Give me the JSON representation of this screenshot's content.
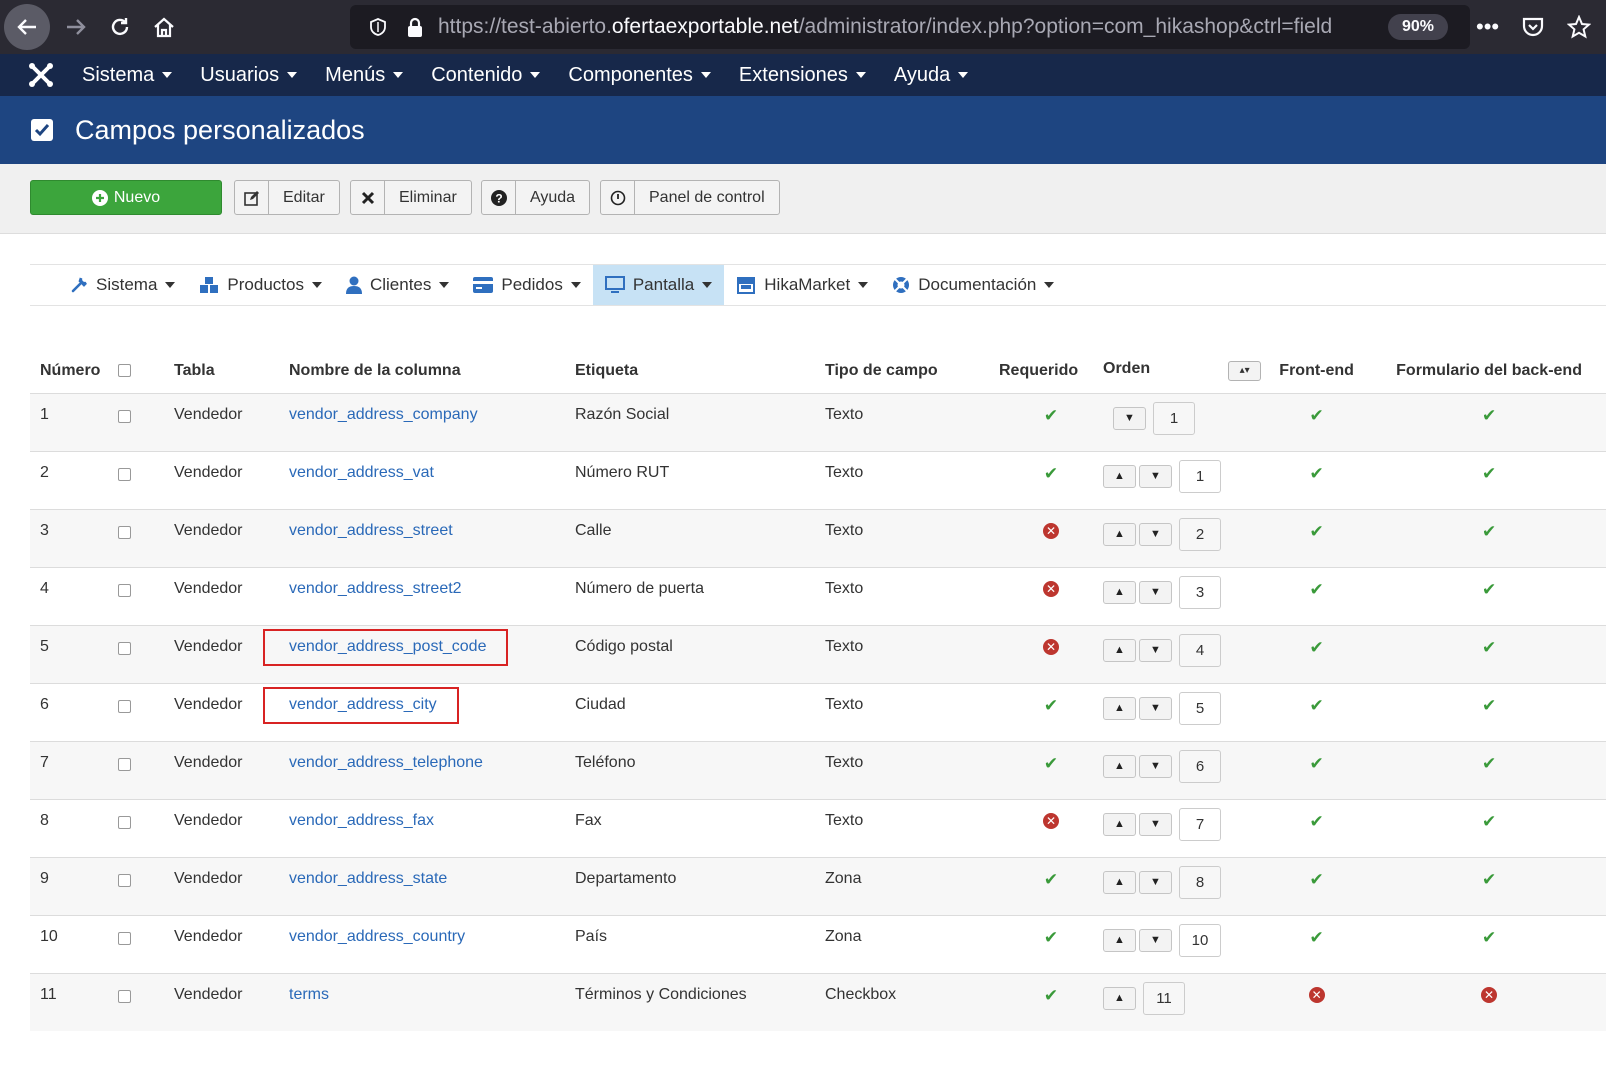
{
  "browser": {
    "url_prefix": "https://test-abierto.",
    "url_host": "ofertaexportable.net",
    "url_path": "/administrator/index.php?option=com_hikashop&ctrl=field",
    "zoom": "90%"
  },
  "topmenu": [
    "Sistema",
    "Usuarios",
    "Menús",
    "Contenido",
    "Componentes",
    "Extensiones",
    "Ayuda"
  ],
  "header": {
    "title": "Campos personalizados"
  },
  "toolbar": {
    "new": "Nuevo",
    "edit": "Editar",
    "delete": "Eliminar",
    "help": "Ayuda",
    "panel": "Panel de control"
  },
  "hikamenu": [
    "Sistema",
    "Productos",
    "Clientes",
    "Pedidos",
    "Pantalla",
    "HikaMarket",
    "Documentación"
  ],
  "table": {
    "headers": {
      "num": "Número",
      "tabla": "Tabla",
      "columna": "Nombre de la columna",
      "etiqueta": "Etiqueta",
      "tipo": "Tipo de campo",
      "requerido": "Requerido",
      "orden": "Orden",
      "front": "Front-end",
      "back": "Formulario del back-end"
    },
    "rows": [
      {
        "num": "1",
        "tabla": "Vendedor",
        "col": "vendor_address_company",
        "label": "Razón Social",
        "tipo": "Texto",
        "req": true,
        "ord": "1",
        "front": true,
        "back": true
      },
      {
        "num": "2",
        "tabla": "Vendedor",
        "col": "vendor_address_vat",
        "label": "Número RUT",
        "tipo": "Texto",
        "req": true,
        "ord": "1",
        "front": true,
        "back": true
      },
      {
        "num": "3",
        "tabla": "Vendedor",
        "col": "vendor_address_street",
        "label": "Calle",
        "tipo": "Texto",
        "req": false,
        "ord": "2",
        "front": true,
        "back": true
      },
      {
        "num": "4",
        "tabla": "Vendedor",
        "col": "vendor_address_street2",
        "label": "Número de puerta",
        "tipo": "Texto",
        "req": false,
        "ord": "3",
        "front": true,
        "back": true
      },
      {
        "num": "5",
        "tabla": "Vendedor",
        "col": "vendor_address_post_code",
        "label": "Código postal",
        "tipo": "Texto",
        "req": false,
        "ord": "4",
        "front": true,
        "back": true
      },
      {
        "num": "6",
        "tabla": "Vendedor",
        "col": "vendor_address_city",
        "label": "Ciudad",
        "tipo": "Texto",
        "req": true,
        "ord": "5",
        "front": true,
        "back": true
      },
      {
        "num": "7",
        "tabla": "Vendedor",
        "col": "vendor_address_telephone",
        "label": "Teléfono",
        "tipo": "Texto",
        "req": true,
        "ord": "6",
        "front": true,
        "back": true
      },
      {
        "num": "8",
        "tabla": "Vendedor",
        "col": "vendor_address_fax",
        "label": "Fax",
        "tipo": "Texto",
        "req": false,
        "ord": "7",
        "front": true,
        "back": true
      },
      {
        "num": "9",
        "tabla": "Vendedor",
        "col": "vendor_address_state",
        "label": "Departamento",
        "tipo": "Zona",
        "req": true,
        "ord": "8",
        "front": true,
        "back": true
      },
      {
        "num": "10",
        "tabla": "Vendedor",
        "col": "vendor_address_country",
        "label": "País",
        "tipo": "Zona",
        "req": true,
        "ord": "10",
        "front": true,
        "back": true
      },
      {
        "num": "11",
        "tabla": "Vendedor",
        "col": "terms",
        "label": "Términos y Condiciones",
        "tipo": "Checkbox",
        "req": true,
        "ord": "11",
        "front": false,
        "back": false
      }
    ]
  }
}
